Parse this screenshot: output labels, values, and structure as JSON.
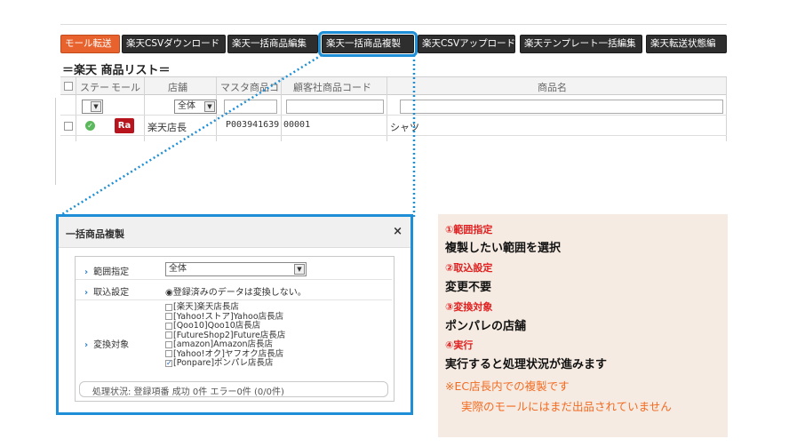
{
  "toolbar": {
    "buttons": [
      "モール転送",
      "楽天CSVダウンロード",
      "楽天一括商品編集",
      "楽天一括商品複製",
      "楽天CSVアップロード",
      "楽天テンプレート一括編集",
      "楽天転送状態編"
    ]
  },
  "grid": {
    "title": "＝楽天 商品リスト＝",
    "columns": [
      "ステー",
      "モール",
      "店舗",
      "マスタ商品コ",
      "顧客社商品コード",
      "商品名"
    ],
    "filter": {
      "status_value": "",
      "store_value": "全体"
    },
    "rows": [
      {
        "mall_badge": "Ra",
        "store": "楽天店長",
        "master_code": "P003941639",
        "customer_code": "00001",
        "product_name": "シャツ"
      }
    ]
  },
  "dialog": {
    "title": "一括商品複製",
    "close": "×",
    "range_label": "範囲指定",
    "range_value": "全体",
    "import_label": "取込設定",
    "import_value": "登録済みのデータは変換しない。",
    "target_label": "変換対象",
    "targets": [
      {
        "text": "[楽天]楽天店長店",
        "checked": false
      },
      {
        "text": "[Yahoo!ストア]Yahoo店長店",
        "checked": false
      },
      {
        "text": "[Qoo10]Qoo10店長店",
        "checked": false
      },
      {
        "text": "[FutureShop2]Future店長店",
        "checked": false
      },
      {
        "text": "[amazon]Amazon店長店",
        "checked": false
      },
      {
        "text": "[Yahoo!オク]ヤフオク店長店",
        "checked": false
      },
      {
        "text": "[Ponpare]ポンパレ店長店",
        "checked": true
      }
    ],
    "status": "処理状況: 登録項番 成功 0件 エラー0件 (0/0件)"
  },
  "note": {
    "s1_title": "①範囲指定",
    "s1_text": "複製したい範囲を選択",
    "s2_title": "②取込設定",
    "s2_text": "変更不要",
    "s3_title": "③変換対象",
    "s3_text": "ポンパレの店舗",
    "s4_title": "④実行",
    "s4_text": "実行すると処理状況が進みます",
    "warn1": "※EC店長内での複製です",
    "warn2": "実際のモールにはまだ出品されていません"
  },
  "colors": {
    "accent": "#1e8fd6",
    "orange": "#e8622d",
    "red": "#e02020",
    "note_bg": "#f6ebe2"
  }
}
